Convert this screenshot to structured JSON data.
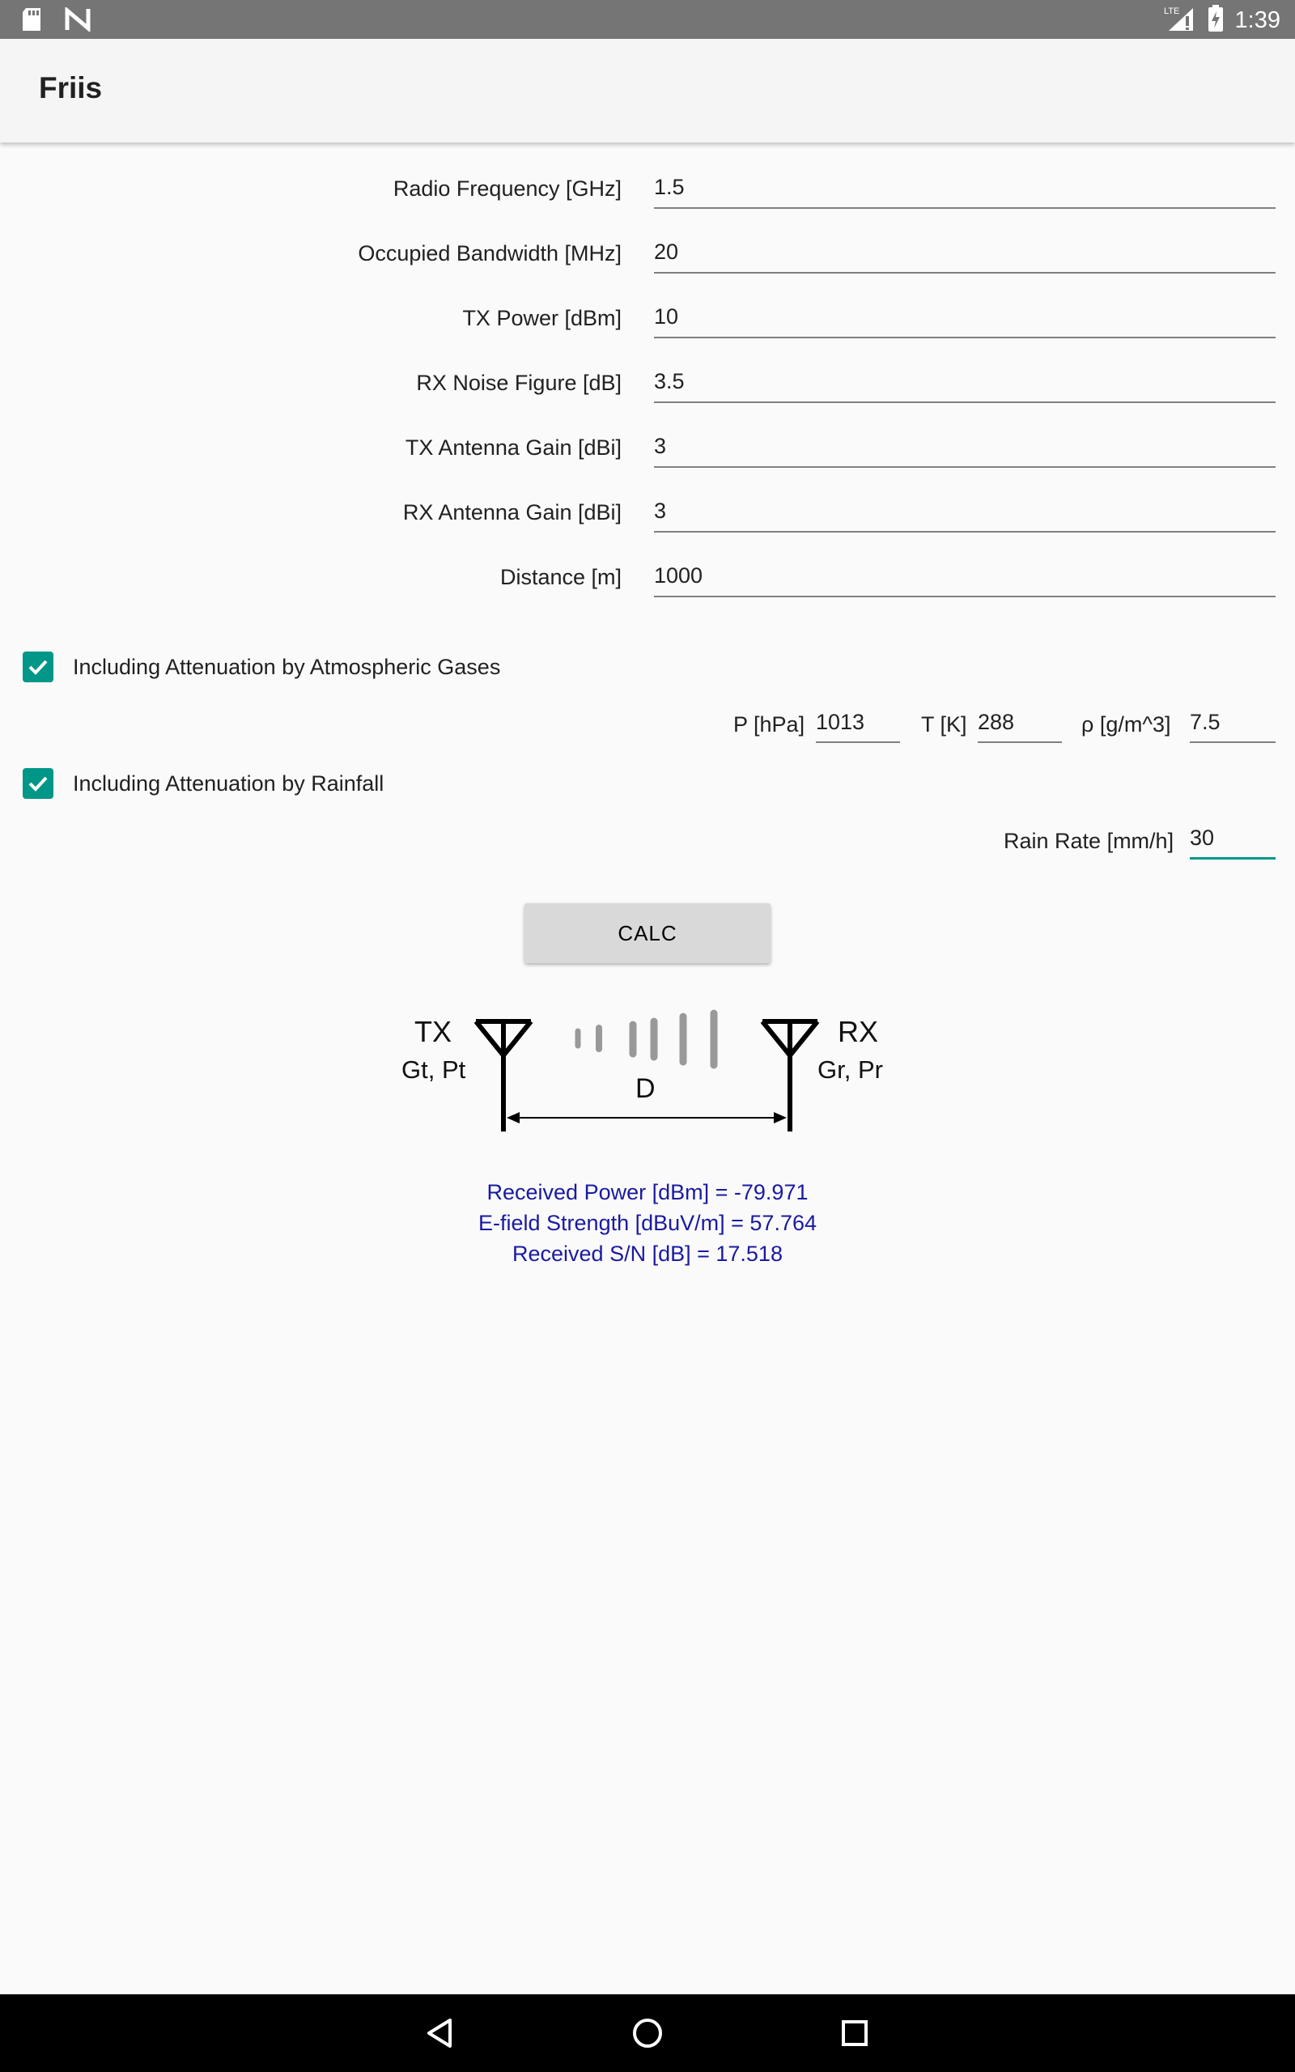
{
  "status_bar": {
    "time": "1:39",
    "network_label": "LTE",
    "icons": [
      "sd-card-icon",
      "n-notification-icon",
      "signal-icon",
      "battery-charging-icon"
    ]
  },
  "app_bar": {
    "title": "Friis"
  },
  "form": {
    "fields": [
      {
        "label": "Radio Frequency [GHz]",
        "value": "1.5"
      },
      {
        "label": "Occupied Bandwidth [MHz]",
        "value": "20"
      },
      {
        "label": "TX Power [dBm]",
        "value": "10"
      },
      {
        "label": "RX Noise Figure [dB]",
        "value": "3.5"
      },
      {
        "label": "TX Antenna Gain [dBi]",
        "value": "3"
      },
      {
        "label": "RX Antenna Gain [dBi]",
        "value": "3"
      },
      {
        "label": "Distance [m]",
        "value": "1000"
      }
    ]
  },
  "atmospheric": {
    "label": "Including Attenuation by Atmospheric Gases",
    "checked": true,
    "pressure_label": "P [hPa]",
    "pressure_value": "1013",
    "temperature_label": "T [K]",
    "temperature_value": "288",
    "density_label": "ρ [g/m^3]",
    "density_value": "7.5"
  },
  "rainfall": {
    "label": "Including Attenuation by Rainfall",
    "checked": true,
    "rate_label": "Rain Rate [mm/h]",
    "rate_value": "30"
  },
  "calc_button": {
    "label": "CALC"
  },
  "diagram": {
    "tx_label": "TX",
    "tx_params": "Gt, Pt",
    "rx_label": "RX",
    "rx_params": "Gr, Pr",
    "distance_label": "D"
  },
  "results": {
    "received_power": "Received Power [dBm] = -79.971",
    "efield_strength": "E-field Strength [dBuV/m] = 57.764",
    "received_sn": "Received S/N [dB] = 17.518"
  },
  "colors": {
    "accent": "#009688",
    "result_text": "#1a1aa0",
    "status_bar": "#757575",
    "nav_bar": "#000000"
  }
}
